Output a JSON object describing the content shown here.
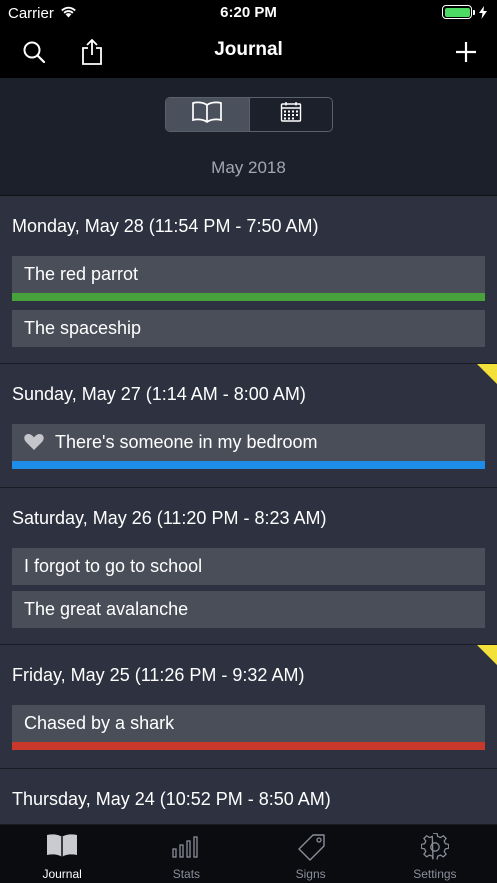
{
  "status_bar": {
    "carrier": "Carrier",
    "time": "6:20 PM"
  },
  "nav": {
    "title": "Journal"
  },
  "header": {
    "month": "May 2018"
  },
  "days": [
    {
      "title": "Monday, May 28 (11:54 PM - 7:50 AM)",
      "flag": false,
      "dreams": [
        {
          "text": "The red parrot",
          "bar_color": "#48a23c"
        },
        {
          "text": "The spaceship",
          "bar_color": null
        }
      ]
    },
    {
      "title": "Sunday, May 27 (1:14 AM - 8:00 AM)",
      "flag": true,
      "dreams": [
        {
          "text": "There's someone in my bedroom",
          "bar_color": "#1d8de8",
          "icon": "heart-icon"
        }
      ]
    },
    {
      "title": "Saturday, May 26 (11:20 PM - 8:23 AM)",
      "flag": false,
      "dreams": [
        {
          "text": "I forgot to go to school",
          "bar_color": null
        },
        {
          "text": "The great avalanche",
          "bar_color": null
        }
      ]
    },
    {
      "title": "Friday, May 25 (11:26 PM - 9:32 AM)",
      "flag": true,
      "dreams": [
        {
          "text": "Chased by a shark",
          "bar_color": "#c8392b"
        }
      ]
    },
    {
      "title": "Thursday, May 24 (10:52 PM - 8:50 AM)",
      "flag": false,
      "dreams": []
    }
  ],
  "tabs": [
    {
      "label": "Journal",
      "icon": "book-icon",
      "active": true
    },
    {
      "label": "Stats",
      "icon": "bar-chart-icon",
      "active": false
    },
    {
      "label": "Signs",
      "icon": "tag-icon",
      "active": false
    },
    {
      "label": "Settings",
      "icon": "gear-icon",
      "active": false
    }
  ],
  "colors": {
    "flag": "#f3e03b",
    "green": "#48a23c",
    "blue": "#1d8de8",
    "red": "#c8392b"
  }
}
